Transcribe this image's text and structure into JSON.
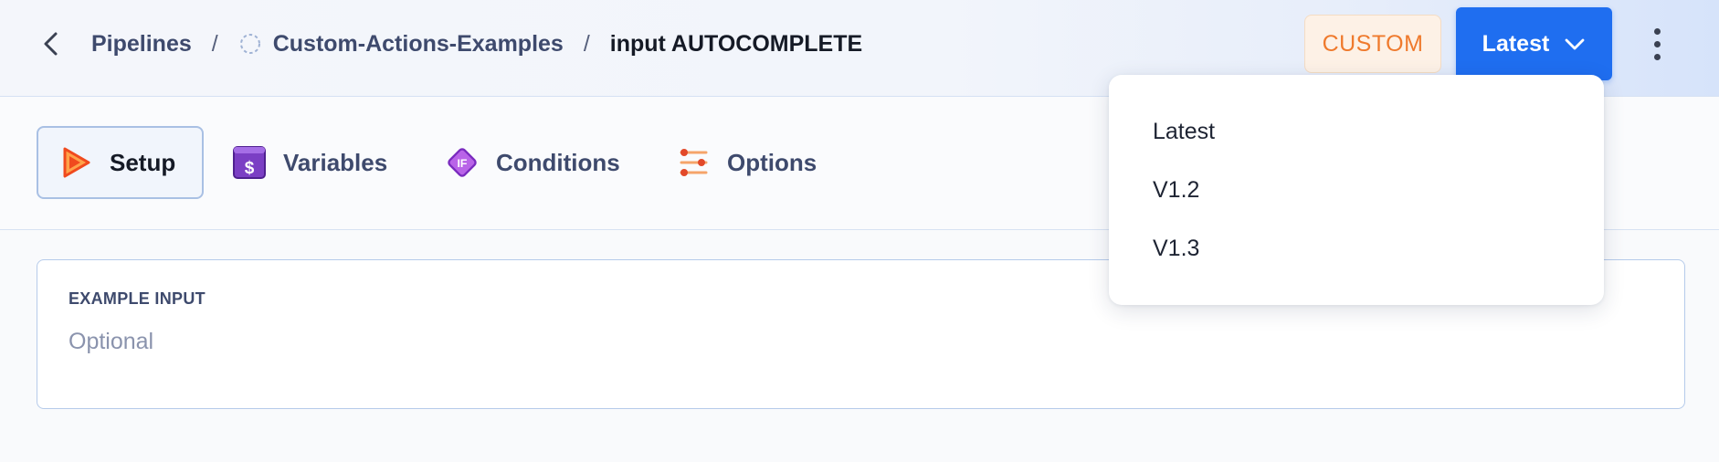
{
  "breadcrumb": {
    "items": [
      "Pipelines",
      "Custom-Actions-Examples"
    ],
    "separator": "/",
    "current": "input AUTOCOMPLETE"
  },
  "header": {
    "badge": "CUSTOM",
    "version_button": "Latest"
  },
  "tabs": [
    {
      "label": "Setup",
      "icon": "play-icon",
      "active": true
    },
    {
      "label": "Variables",
      "icon": "dollar-icon",
      "active": false
    },
    {
      "label": "Conditions",
      "icon": "if-diamond-icon",
      "active": false
    },
    {
      "label": "Options",
      "icon": "sliders-icon",
      "active": false
    }
  ],
  "form": {
    "label": "EXAMPLE INPUT",
    "placeholder": "Optional",
    "value": ""
  },
  "version_menu": {
    "options": [
      "Latest",
      "V1.2",
      "V1.3"
    ]
  },
  "colors": {
    "accent": "#1f6ef0",
    "badge_text": "#ef7a2d",
    "badge_bg": "#fdf1e6",
    "variables_icon": "#7b3fc4",
    "conditions_icon": "#a44ad6",
    "setup_icon": "#f04a1e",
    "options_icon": "#e2492a"
  }
}
